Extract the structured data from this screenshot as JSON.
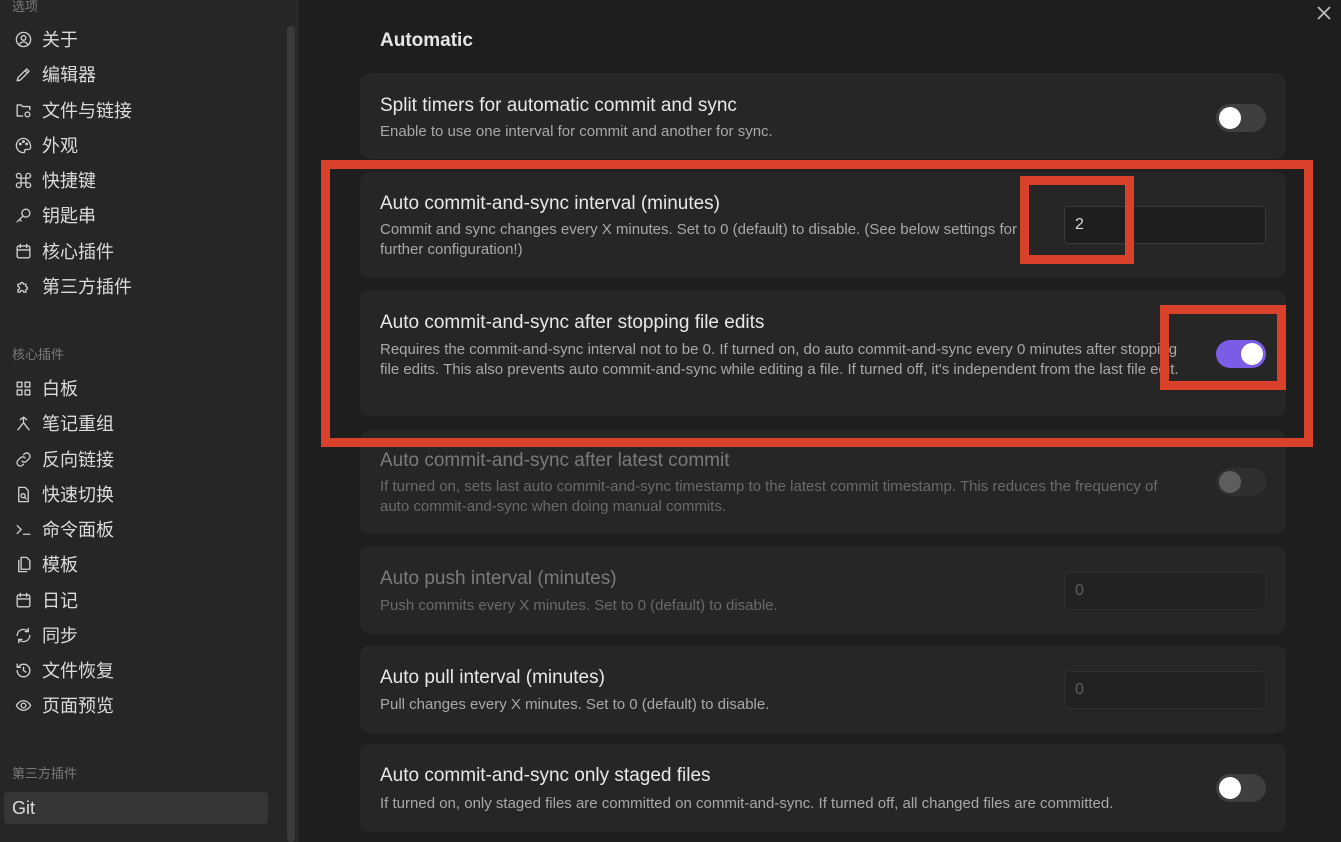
{
  "sidebar": {
    "options_heading": "选项",
    "options": [
      {
        "label": "关于",
        "icon": "user-circle-icon"
      },
      {
        "label": "编辑器",
        "icon": "pencil-icon"
      },
      {
        "label": "文件与链接",
        "icon": "folder-cog-icon"
      },
      {
        "label": "外观",
        "icon": "palette-icon"
      },
      {
        "label": "快捷键",
        "icon": "command-icon"
      },
      {
        "label": "钥匙串",
        "icon": "key-icon"
      },
      {
        "label": "核心插件",
        "icon": "calendar-icon"
      },
      {
        "label": "第三方插件",
        "icon": "puzzle-icon"
      }
    ],
    "core_heading": "核心插件",
    "core": [
      {
        "label": "白板",
        "icon": "layout-grid-icon"
      },
      {
        "label": "笔记重组",
        "icon": "merge-icon"
      },
      {
        "label": "反向链接",
        "icon": "link-icon"
      },
      {
        "label": "快速切换",
        "icon": "file-search-icon"
      },
      {
        "label": "命令面板",
        "icon": "terminal-icon"
      },
      {
        "label": "模板",
        "icon": "files-icon"
      },
      {
        "label": "日记",
        "icon": "calendar-icon"
      },
      {
        "label": "同步",
        "icon": "refresh-icon"
      },
      {
        "label": "文件恢复",
        "icon": "history-icon"
      },
      {
        "label": "页面预览",
        "icon": "eye-icon"
      }
    ],
    "third_heading": "第三方插件",
    "third": [
      {
        "label": "Git"
      }
    ]
  },
  "main": {
    "section_title": "Automatic",
    "settings": [
      {
        "title": "Split timers for automatic commit and sync",
        "desc": "Enable to use one interval for commit and another for sync.",
        "control": "toggle",
        "on": false
      },
      {
        "title": "Auto commit-and-sync interval (minutes)",
        "desc": "Commit and sync changes every X minutes. Set to 0 (default) to disable. (See below settings for further configuration!)",
        "control": "input",
        "value": "2"
      },
      {
        "title": "Auto commit-and-sync after stopping file edits",
        "desc": "Requires the commit-and-sync interval not to be 0. If turned on, do auto commit-and-sync every 0 minutes after stopping file edits. This also prevents auto commit-and-sync while editing a file. If turned off, it's independent from the last file edit.",
        "control": "toggle",
        "on": true
      },
      {
        "title": "Auto commit-and-sync after latest commit",
        "desc": "If turned on, sets last auto commit-and-sync timestamp to the latest commit timestamp. This reduces the frequency of auto commit-and-sync when doing manual commits.",
        "control": "toggle",
        "on": false
      },
      {
        "title": "Auto push interval (minutes)",
        "desc": "Push commits every X minutes. Set to 0 (default) to disable.",
        "control": "input",
        "value": "0"
      },
      {
        "title": "Auto pull interval (minutes)",
        "desc": "Pull changes every X minutes. Set to 0 (default) to disable.",
        "control": "input",
        "value": "0"
      },
      {
        "title": "Auto commit-and-sync only staged files",
        "desc": "If turned on, only staged files are committed on commit-and-sync. If turned off, all changed files are committed.",
        "control": "toggle",
        "on": false
      }
    ]
  },
  "colors": {
    "accent": "#7b5ce6",
    "annotation": "#d9412a"
  }
}
